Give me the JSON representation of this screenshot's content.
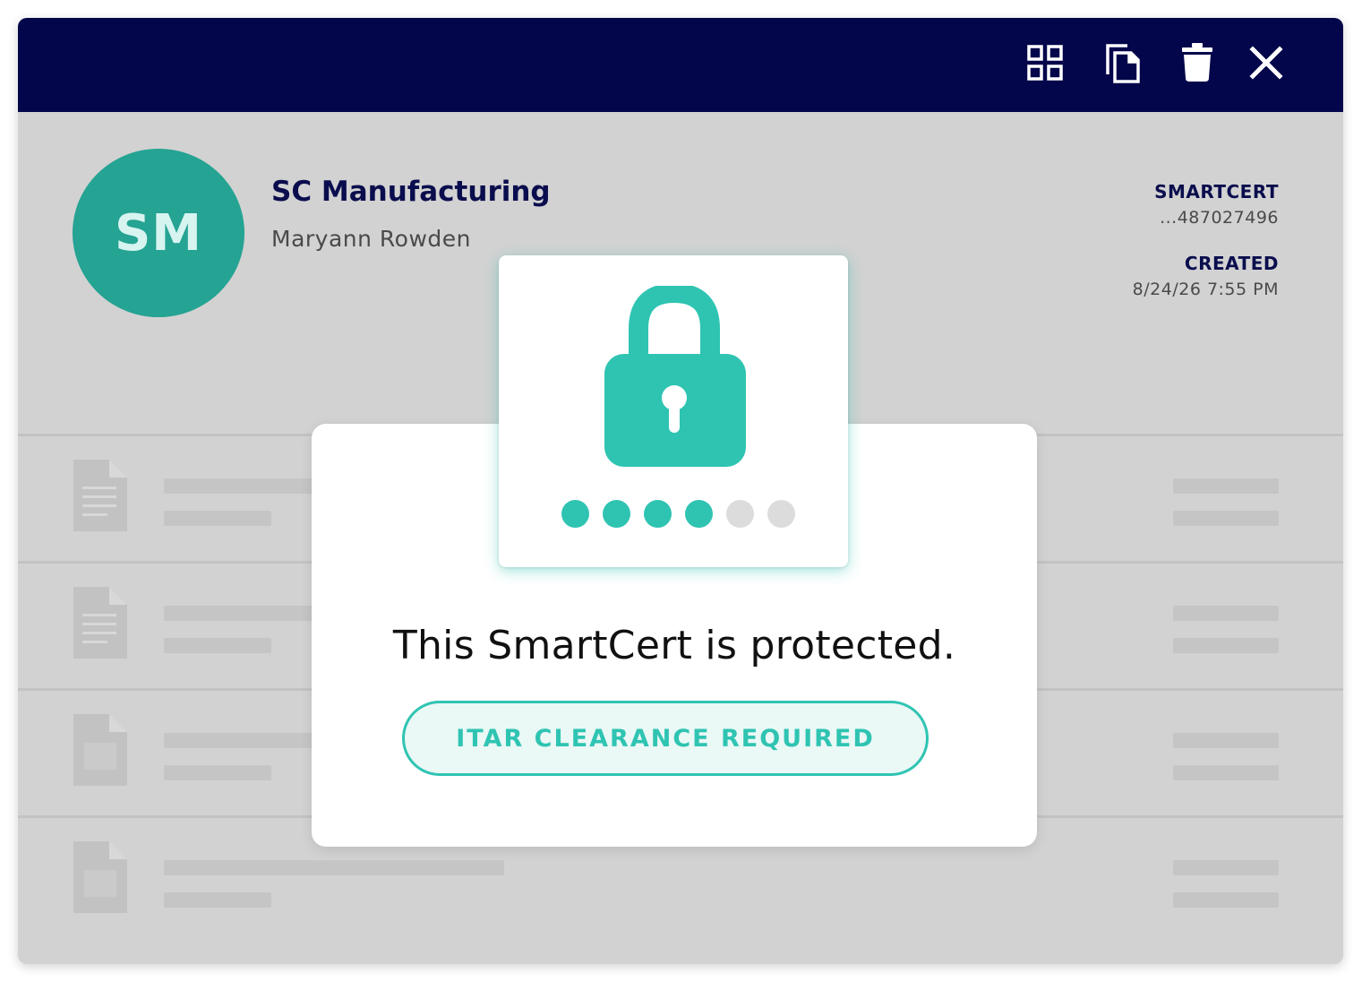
{
  "toolbar": {
    "icons": [
      "grid-icon",
      "copy-icon",
      "trash-icon",
      "close-icon"
    ]
  },
  "profile": {
    "initials": "SM",
    "company": "SC Manufacturing",
    "person": "Maryann Rowden"
  },
  "meta": {
    "smartcert_label": "SMARTCERT",
    "smartcert_value": "...487027496",
    "created_label": "CREATED",
    "created_value": "8/24/26 7:55 PM"
  },
  "modal": {
    "headline": "This SmartCert is protected.",
    "badge": "ITAR CLEARANCE REQUIRED",
    "pin_filled": 4,
    "pin_total": 6
  },
  "colors": {
    "titlebar": "#03064a",
    "accent": "#2fc4b2",
    "avatar": "#25a393"
  }
}
